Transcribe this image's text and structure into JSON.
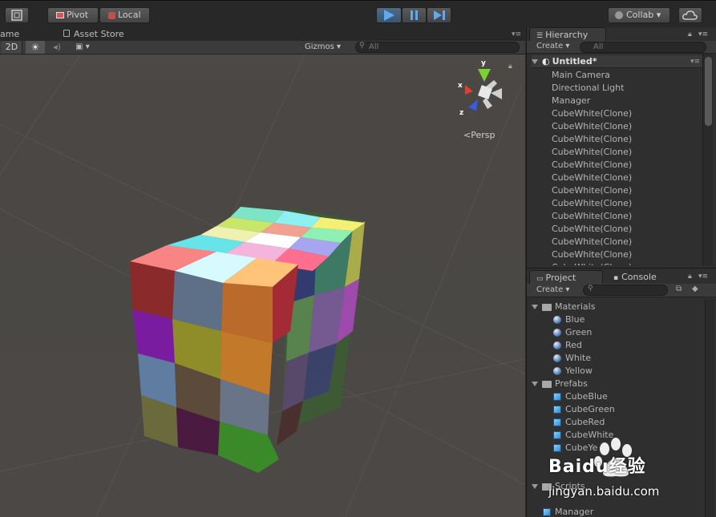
{
  "toolbar": {
    "pivot_label": "Pivot",
    "local_label": "Local",
    "collab_label": "Collab ▾"
  },
  "scene": {
    "game_tab": "ame",
    "asset_store_tab": "Asset Store",
    "mode_2d": "2D",
    "gizmos_label": "Gizmos",
    "search_placeholder": "All",
    "persp_label": "Persp",
    "axis_y": "y",
    "axis_x": "x",
    "axis_z": "z"
  },
  "hierarchy": {
    "tab_label": "Hierarchy",
    "create_label": "Create",
    "search_placeholder": "All",
    "scene_name": "Untitled*",
    "items": [
      "Main Camera",
      "Directional Light",
      "Manager",
      "CubeWhite(Clone)",
      "CubeWhite(Clone)",
      "CubeWhite(Clone)",
      "CubeWhite(Clone)",
      "CubeWhite(Clone)",
      "CubeWhite(Clone)",
      "CubeWhite(Clone)",
      "CubeWhite(Clone)",
      "CubeWhite(Clone)",
      "CubeWhite(Clone)",
      "CubeWhite(Clone)",
      "CubeWhite(Clone)",
      "CubeWhite(Clone)"
    ]
  },
  "project": {
    "tab_label": "Project",
    "console_tab": "Console",
    "create_label": "Create",
    "materials_folder": "Materials",
    "materials": [
      "Blue",
      "Green",
      "Red",
      "White",
      "Yellow"
    ],
    "prefabs_folder": "Prefabs",
    "prefabs": [
      "CubeBlue",
      "CubeGreen",
      "CubeRed",
      "CubeWhite",
      "CubeYe"
    ],
    "scripts_folder": "Scripts",
    "scripts": [
      "Manager"
    ]
  },
  "watermark": {
    "brand": "Baidu经验",
    "url": "jingyan.baidu.com"
  }
}
